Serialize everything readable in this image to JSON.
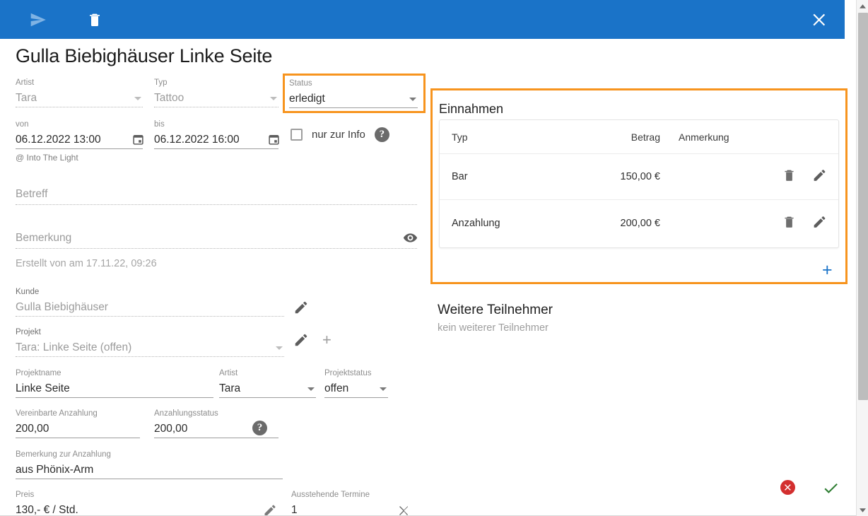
{
  "toolbar": {
    "send_icon": "send-icon",
    "delete_icon": "trash-icon",
    "close_icon": "close-icon"
  },
  "page_title": "Gulla Biebighäuser Linke Seite",
  "appointment": {
    "artist": {
      "label": "Artist",
      "value": "Tara"
    },
    "typ": {
      "label": "Typ",
      "value": "Tattoo"
    },
    "status": {
      "label": "Status",
      "value": "erledigt"
    },
    "von": {
      "label": "von",
      "value": "06.12.2022 13:00"
    },
    "bis": {
      "label": "bis",
      "value": "06.12.2022 16:00"
    },
    "info_only": {
      "label": "nur zur Info",
      "checked": false
    },
    "location": "@ Into The Light",
    "betreff": {
      "label": "Betreff",
      "value": ""
    },
    "bemerkung": {
      "label": "Bemerkung",
      "value": ""
    },
    "created": "Erstellt von am 17.11.22, 09:26",
    "kunde": {
      "label": "Kunde",
      "value": "Gulla Biebighäuser"
    },
    "projekt": {
      "label": "Projekt",
      "value": "Tara: Linke Seite (offen)"
    }
  },
  "project": {
    "projektname": {
      "label": "Projektname",
      "value": "Linke Seite"
    },
    "artist": {
      "label": "Artist",
      "value": "Tara"
    },
    "projektstatus": {
      "label": "Projektstatus",
      "value": "offen"
    },
    "vereinbarte_anzahlung": {
      "label": "Vereinbarte Anzahlung",
      "value": "200,00"
    },
    "anzahlungsstatus": {
      "label": "Anzahlungsstatus",
      "value": "200,00"
    },
    "bemerkung_anzahlung": {
      "label": "Bemerkung zur Anzahlung",
      "value": "aus Phönix-Arm"
    },
    "preis": {
      "label": "Preis",
      "value": "130,- € / Std."
    },
    "ausstehende_termine": {
      "label": "Ausstehende Termine",
      "value": "1"
    }
  },
  "einnahmen": {
    "title": "Einnahmen",
    "columns": [
      "Typ",
      "Betrag",
      "Anmerkung"
    ],
    "rows": [
      {
        "typ": "Bar",
        "betrag": "150,00 €",
        "anmerkung": ""
      },
      {
        "typ": "Anzahlung",
        "betrag": "200,00 €",
        "anmerkung": ""
      }
    ],
    "add_label": "+"
  },
  "teilnehmer": {
    "title": "Weitere Teilnehmer",
    "empty_text": "kein weiterer Teilnehmer"
  },
  "colors": {
    "toolbar_blue": "#1a73c8",
    "highlight_orange": "#f7941e",
    "cancel_red": "#d32f2f",
    "confirm_green": "#2e7d32",
    "accent_blue": "#1a73c8"
  }
}
